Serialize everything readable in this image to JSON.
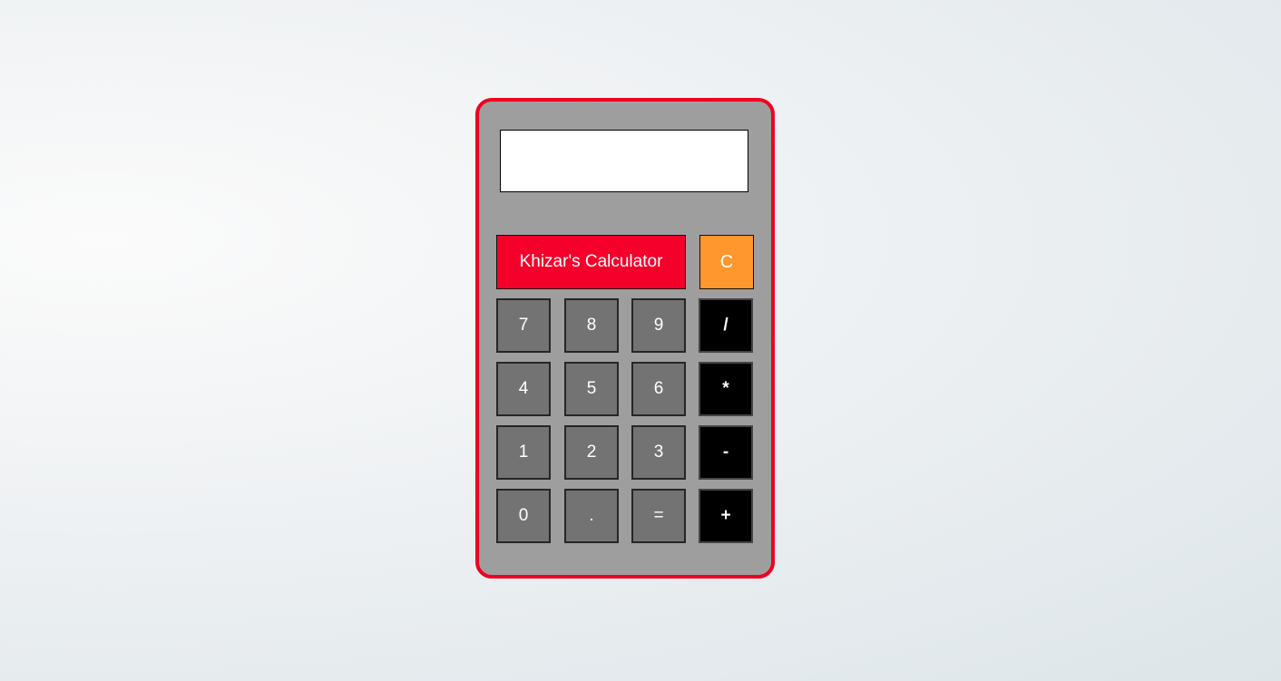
{
  "display": {
    "value": "",
    "placeholder": ""
  },
  "header": {
    "title_label": "Khizar's Calculator",
    "clear_label": "C"
  },
  "keypad": {
    "row1": [
      "7",
      "8",
      "9",
      "/"
    ],
    "row2": [
      "4",
      "5",
      "6",
      "*"
    ],
    "row3": [
      "1",
      "2",
      "3",
      "-"
    ],
    "row4": [
      "0",
      ".",
      "=",
      "+"
    ]
  },
  "colors": {
    "frame_border": "#f0001f",
    "body": "#9e9e9e",
    "title_button": "#f4002a",
    "clear_button": "#ff962e",
    "number_button": "#737373",
    "operator_button": "#000000"
  }
}
